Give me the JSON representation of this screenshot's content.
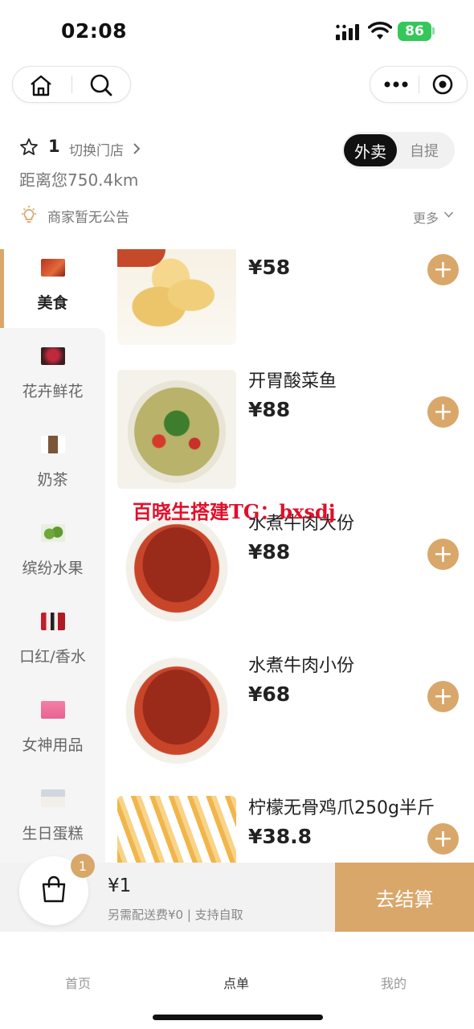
{
  "status_bar": {
    "time": "02:08",
    "battery": "86"
  },
  "capsule": {
    "home_icon": "home-icon",
    "search_icon": "search-icon",
    "more_icon": "more-dots-icon",
    "close_icon": "target-close-icon"
  },
  "store": {
    "name": "1",
    "switch_label": "切换门店",
    "distance": "距离您750.4km",
    "notice": "商家暂无公告",
    "more": "更多",
    "delivery_modes": [
      "外卖",
      "自提"
    ],
    "active_mode": "外卖"
  },
  "categories": [
    {
      "label": "美食",
      "active": true
    },
    {
      "label": "花卉鲜花"
    },
    {
      "label": "奶茶"
    },
    {
      "label": "缤纷水果"
    },
    {
      "label": "口红/香水"
    },
    {
      "label": "女神用品"
    },
    {
      "label": "生日蛋糕"
    }
  ],
  "products": [
    {
      "name": "",
      "price": "¥58"
    },
    {
      "name": "开胃酸菜鱼",
      "price": "¥88"
    },
    {
      "name": "水煮牛肉大份",
      "price": "¥88"
    },
    {
      "name": "水煮牛肉小份",
      "price": "¥68"
    },
    {
      "name": "柠檬无骨鸡爪250g半斤",
      "price": "¥38.8"
    }
  ],
  "watermark": "百晓生搭建TG：bxsdj",
  "cart": {
    "badge": "1",
    "total": "¥1",
    "subtext": "另需配送费¥0 | 支持自取",
    "checkout": "去结算"
  },
  "tabbar": {
    "items": [
      "首页",
      "点单",
      "我的"
    ],
    "active": "点单"
  },
  "colors": {
    "accent": "#d9a76a",
    "watermark": "#e0102a",
    "battery": "#34c759"
  }
}
